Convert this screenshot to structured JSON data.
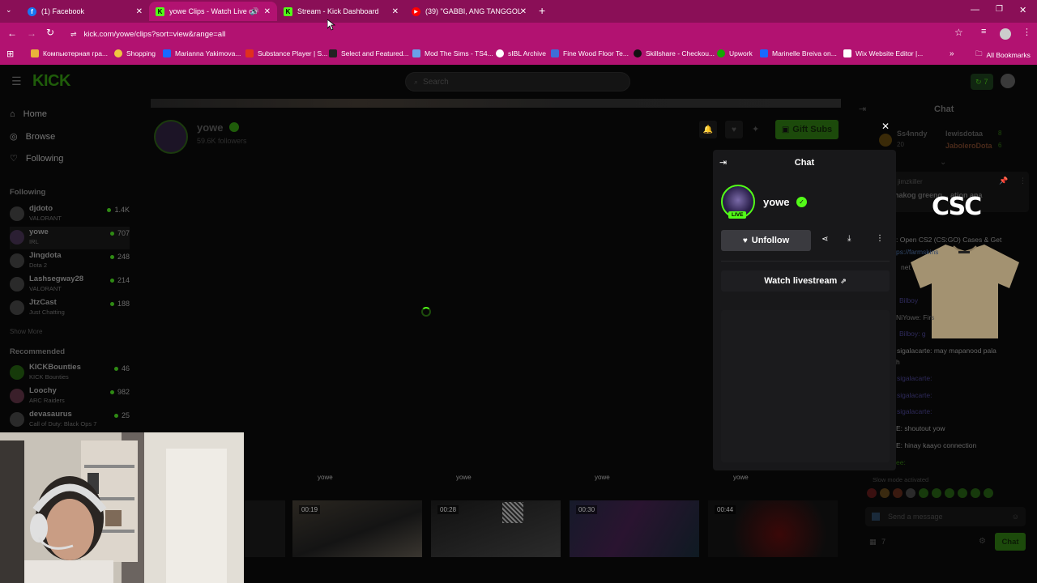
{
  "browser": {
    "tabs": [
      {
        "title": "(1) Facebook"
      },
      {
        "title": "yowe Clips - Watch Live on"
      },
      {
        "title": "Stream - Kick Dashboard"
      },
      {
        "title": "(39) \"GABBI, ANG TANGGOL N"
      }
    ],
    "url": "kick.com/yowe/clips?sort=view&range=all",
    "bookmarks": [
      "Компьютерная гра...",
      "Shopping",
      "Marianna Yakimova...",
      "Substance Player | S...",
      "Select and Featured...",
      "Mod The Sims - TS4...",
      "sIBL Archive",
      "Fine Wood Floor Te...",
      "Skillshare - Checkou...",
      "Upwork",
      "Marinelle Breiva on...",
      "Wix Website Editor |..."
    ],
    "all_bookmarks": "All Bookmarks"
  },
  "header": {
    "logo": "KICK",
    "search_placeholder": "Search",
    "credits": "7"
  },
  "sidebar": {
    "nav": {
      "home": "Home",
      "browse": "Browse",
      "following": "Following"
    },
    "following_heading": "Following",
    "following": [
      {
        "name": "djdoto",
        "game": "VALORANT",
        "viewers": "1.4K"
      },
      {
        "name": "yowe",
        "game": "IRL",
        "viewers": "707"
      },
      {
        "name": "Jingdota",
        "game": "Dota 2",
        "viewers": "248"
      },
      {
        "name": "Lashsegway28",
        "game": "VALORANT",
        "viewers": "214"
      },
      {
        "name": "JtzCast",
        "game": "Just Chatting",
        "viewers": "188"
      }
    ],
    "show_more": "Show More",
    "recommended_heading": "Recommended",
    "recommended": [
      {
        "name": "KICKBounties",
        "game": "KICK Bounties",
        "viewers": "46"
      },
      {
        "name": "Loochy",
        "game": "ARC Raiders",
        "viewers": "982"
      },
      {
        "name": "devasaurus",
        "game": "Call of Duty: Black Ops 7",
        "viewers": "25"
      }
    ]
  },
  "channel": {
    "name": "yowe",
    "followers": "59.6K followers",
    "gift_subs": "Gift Subs"
  },
  "clips": {
    "authors": [
      "yowe",
      "yowe",
      "yowe",
      "yowe"
    ],
    "durations": [
      "00:19",
      "00:28",
      "00:30",
      "00:44"
    ]
  },
  "popup": {
    "title": "Chat",
    "username": "yowe",
    "live_badge": "LIVE",
    "unfollow": "Unfollow",
    "watch_livestream": "Watch livestream"
  },
  "chat": {
    "title": "Chat",
    "gifters": [
      {
        "name": "Ss4nndy",
        "count": "20"
      },
      {
        "name": "lewisdotaa",
        "count": "8"
      },
      {
        "name": "JaboleroDota",
        "count": "6"
      }
    ],
    "pinned_user": "jimzkiller",
    "pinned_text": "hakog greeng... ation ana",
    "overlay_logo": "CSC",
    "messages": [
      ": Open CS2 (CS:GO) Cases & Get",
      "ps://farmskins",
      "net",
      "Bilboy",
      "NiYowe: Firs",
      "Bilboy: g",
      "sigalacarte: may mapanood pala",
      "h",
      "sigalacarte:",
      "sigalacarte:",
      "sigalacarte:",
      "E: shoutout yow",
      "E: hinay kaayo connection",
      "ee:"
    ],
    "slow_mode": "Slow mode activated",
    "input_placeholder": "Send a message",
    "counter": "7",
    "send": "Chat"
  },
  "colors": {
    "kick_green": "#53fc18",
    "tab_bar": "#8a0f57",
    "chrome": "#b21271"
  }
}
